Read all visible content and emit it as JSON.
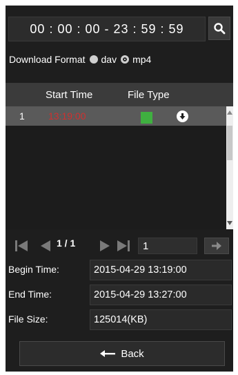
{
  "time_range": {
    "value": "00 : 00 : 00 - 23 : 59 : 59"
  },
  "search": {
    "icon": "search-icon"
  },
  "download_format": {
    "label": "Download Format",
    "options": [
      {
        "label": "dav",
        "selected": false
      },
      {
        "label": "mp4",
        "selected": true
      }
    ]
  },
  "table": {
    "columns": {
      "start_time": "Start Time",
      "file_type": "File Type"
    },
    "rows": [
      {
        "index": "1",
        "start_time": "13:19:00",
        "file_type_color": "#3fb040",
        "download_icon": "download-icon"
      }
    ]
  },
  "pagination": {
    "page_text": "1 / 1",
    "page_input": "1"
  },
  "info": {
    "begin_label": "Begin Time:",
    "begin_value": "2015-04-29 13:19:00",
    "end_label": "End Time:",
    "end_value": "2015-04-29 13:27:00",
    "size_label": "File Size:",
    "size_value": "125014(KB)"
  },
  "back": {
    "label": "Back"
  },
  "colors": {
    "background": "#1e1e1e",
    "highlight_time": "#d0302f",
    "file_type": "#3fb040"
  }
}
